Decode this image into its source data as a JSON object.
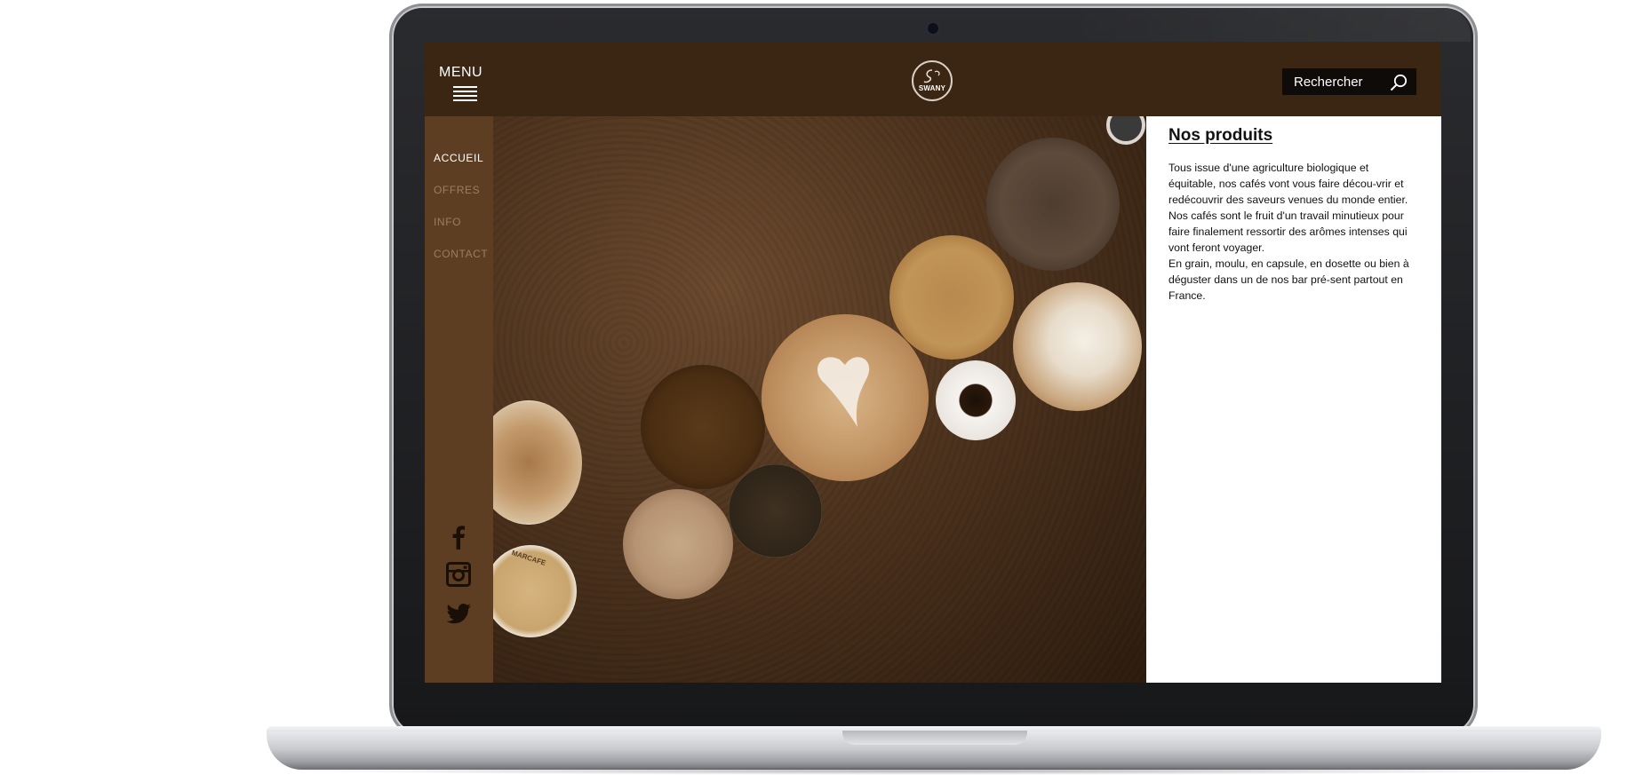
{
  "header": {
    "menu_label": "MENU",
    "logo_text": "SWANY",
    "search_placeholder": "Rechercher"
  },
  "sidebar": {
    "items": [
      {
        "label": "ACCUEIL",
        "active": true
      },
      {
        "label": "OFFRES",
        "active": false
      },
      {
        "label": "INFO",
        "active": false
      },
      {
        "label": "CONTACT",
        "active": false
      }
    ],
    "social": [
      "facebook-icon",
      "instagram-icon",
      "twitter-icon"
    ]
  },
  "hero": {
    "cup_text": "MARCAFE"
  },
  "content": {
    "title": "Nos produits",
    "paragraphs": [
      "Tous issue  d'une agriculture biologique et équitable, nos cafés vont vous faire décou-vrir et redécouvrir des saveurs venues du monde entier.",
      "Nos cafés sont le fruit d'un travail minutieux pour faire finalement ressortir des arômes intenses qui vont feront voyager.",
      "En grain, moulu, en capsule, en dosette ou bien à déguster dans un de nos bar pré-sent partout en France."
    ]
  },
  "colors": {
    "topbar": "#3a2612",
    "sidebar": "#5e3e22",
    "panel": "#ffffff",
    "search_bg": "#0f0b08"
  }
}
